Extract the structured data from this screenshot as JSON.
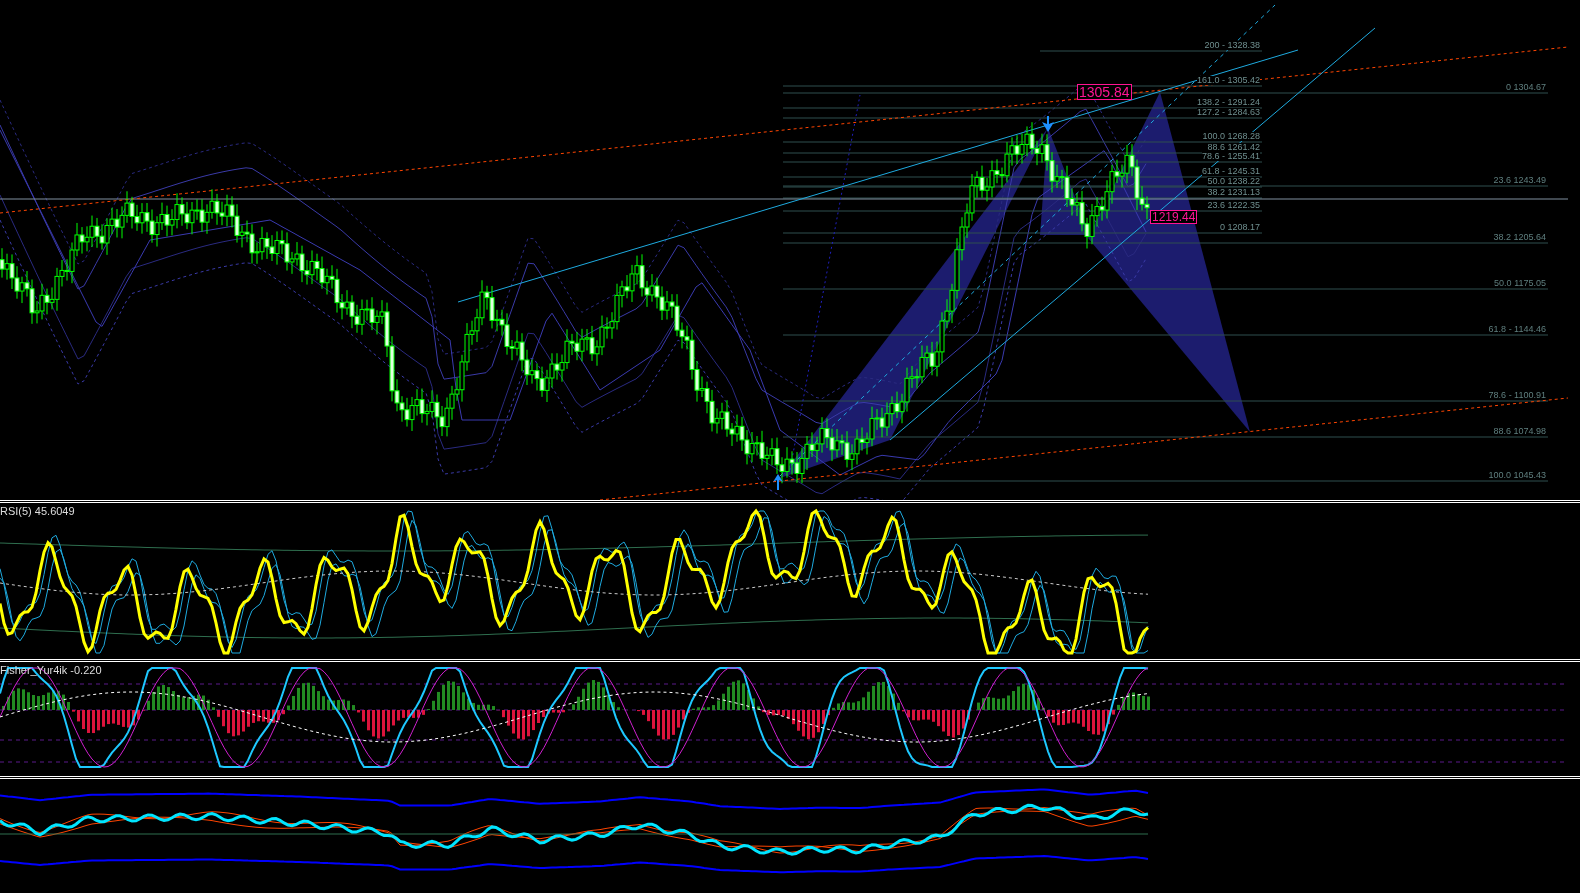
{
  "price_chart": {
    "fib_levels_upper": [
      {
        "text": "200 - 1328.38"
      },
      {
        "text": "161.0 - 1305.42"
      },
      {
        "text": "138.2 - 1291.24"
      },
      {
        "text": "127.2 - 1284.63"
      },
      {
        "text": "100.0 1268.28"
      },
      {
        "text": "88.6 1261.42"
      },
      {
        "text": "78.6 - 1255.41"
      },
      {
        "text": "61.8 - 1245.31"
      },
      {
        "text": "50.0 1238.22"
      },
      {
        "text": "38.2 1231.13"
      },
      {
        "text": "23.6 1222.35"
      },
      {
        "text": "0 1208.17"
      }
    ],
    "fib_levels_lower": [
      {
        "text": "0 1304.67"
      },
      {
        "text": "23.6 1243.49"
      },
      {
        "text": "38.2 1205.64"
      },
      {
        "text": "50.0 1175.05"
      },
      {
        "text": "61.8 - 1144.46"
      },
      {
        "text": "78.6 - 1100.91"
      },
      {
        "text": "88.6 1074.98"
      },
      {
        "text": "100.0 1045.43"
      }
    ],
    "price_labels": [
      {
        "text": "1305.84"
      },
      {
        "text": "1219.44"
      }
    ]
  },
  "rsi_panel": {
    "label": "RSI(5) 45.6049"
  },
  "fisher_panel": {
    "label": "Fisher_Yur4ik -0.220"
  }
}
